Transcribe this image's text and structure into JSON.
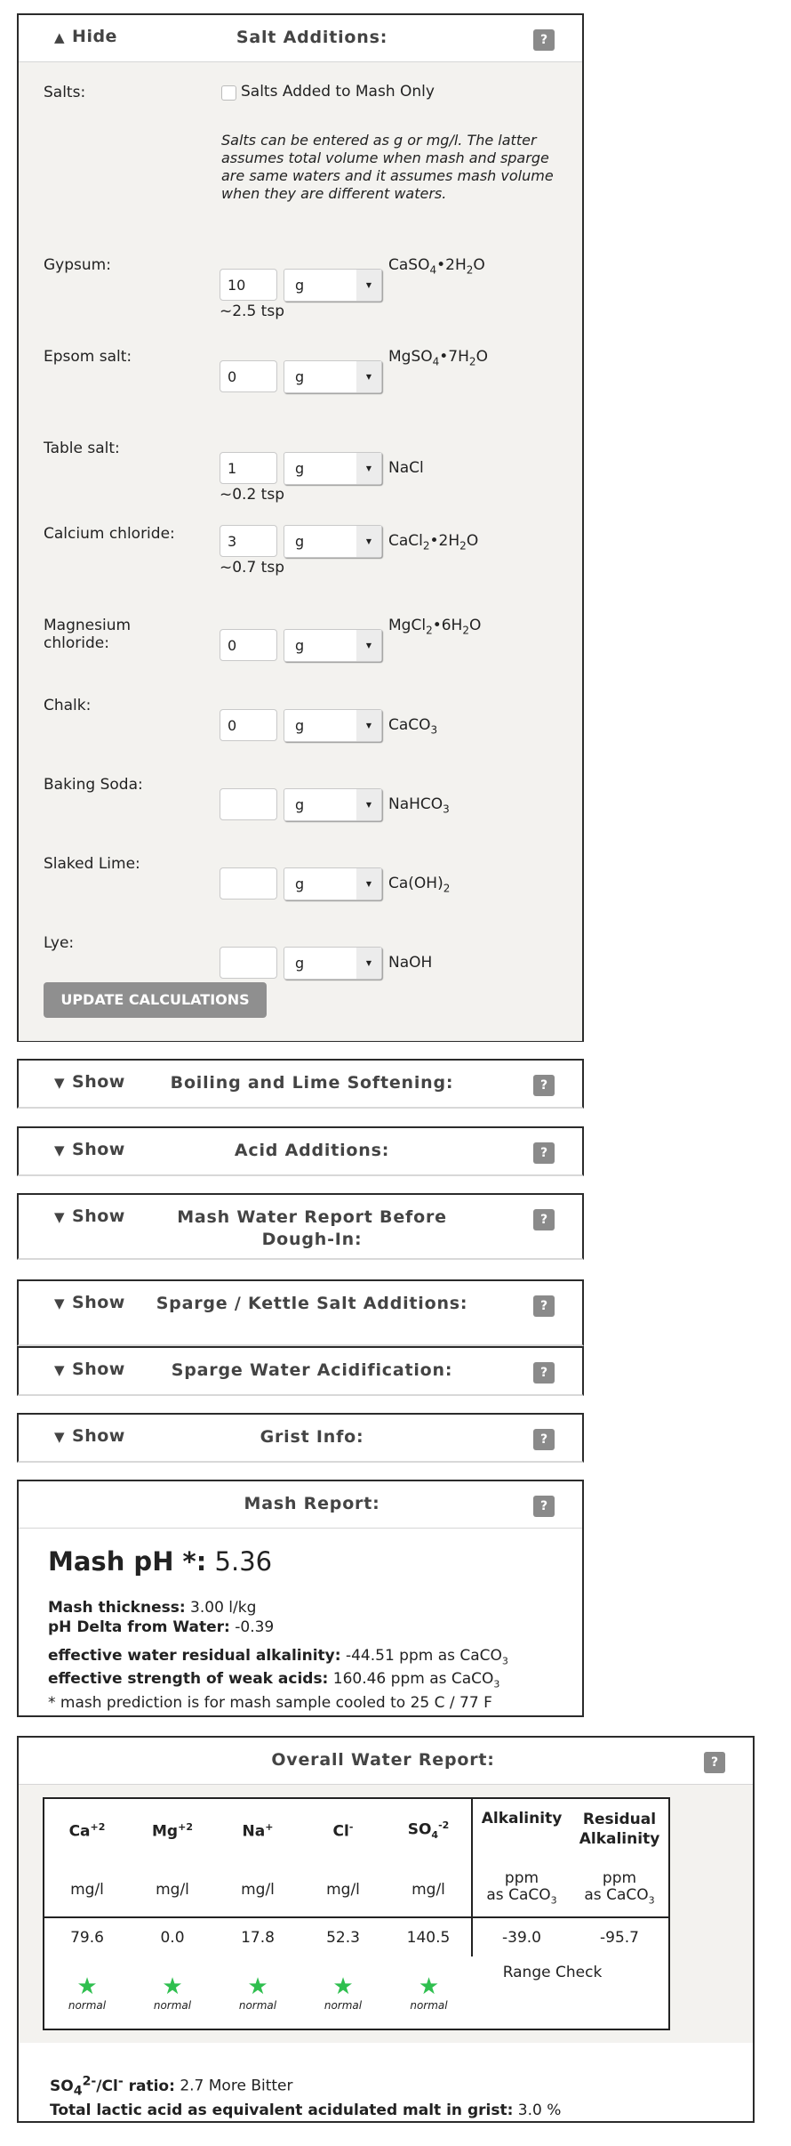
{
  "salt_additions": {
    "toggle_label": "Hide",
    "title": "Salt Additions:",
    "help_icon": "?",
    "salts_label": "Salts:",
    "mash_only_checkbox_label": "Salts Added to Mash Only",
    "mash_only_checked": false,
    "note": "Salts can be entered as g or mg/l. The latter assumes total volume when mash and sparge are same waters and it assumes mash volume when they are different waters.",
    "rows": [
      {
        "label": "Gypsum:",
        "value": "10",
        "unit": "g",
        "formula_html": "CaSO<sub>4</sub>•2H<sub>2</sub>O",
        "tsp": "~2.5 tsp"
      },
      {
        "label": "Epsom salt:",
        "value": "0",
        "unit": "g",
        "formula_html": "MgSO<sub>4</sub>•7H<sub>2</sub>O",
        "tsp": ""
      },
      {
        "label": "Table salt:",
        "value": "1",
        "unit": "g",
        "formula_html": "NaCl",
        "tsp": "~0.2 tsp"
      },
      {
        "label": "Calcium chloride:",
        "value": "3",
        "unit": "g",
        "formula_html": "CaCl<sub>2</sub>•2H<sub>2</sub>O",
        "tsp": "~0.7 tsp"
      },
      {
        "label": "Magnesium chloride:",
        "value": "0",
        "unit": "g",
        "formula_html": "MgCl<sub>2</sub>•6H<sub>2</sub>O",
        "tsp": ""
      },
      {
        "label": "Chalk:",
        "value": "0",
        "unit": "g",
        "formula_html": "CaCO<sub>3</sub>",
        "tsp": ""
      },
      {
        "label": "Baking Soda:",
        "value": "",
        "unit": "g",
        "formula_html": "NaHCO<sub>3</sub>",
        "tsp": ""
      },
      {
        "label": "Slaked Lime:",
        "value": "",
        "unit": "g",
        "formula_html": "Ca(OH)<sub>2</sub>",
        "tsp": ""
      },
      {
        "label": "Lye:",
        "value": "",
        "unit": "g",
        "formula_html": "NaOH",
        "tsp": ""
      }
    ],
    "update_button": "UPDATE CALCULATIONS"
  },
  "collapsed_sections": [
    {
      "toggle_label": "Show",
      "title": "Boiling and Lime Softening:"
    },
    {
      "toggle_label": "Show",
      "title": "Acid Additions:"
    },
    {
      "toggle_label": "Show",
      "title": "Mash Water Report Before Dough-In:"
    },
    {
      "toggle_label": "Show",
      "title": "Sparge / Kettle Salt Additions:"
    },
    {
      "toggle_label": "Show",
      "title": "Sparge Water Acidification:"
    },
    {
      "toggle_label": "Show",
      "title": "Grist Info:"
    }
  ],
  "mash_report": {
    "title": "Mash Report:",
    "ph_label": "Mash pH *:",
    "ph_value": "5.36",
    "thickness_label": "Mash thickness:",
    "thickness_value": "3.00 l/kg",
    "ph_delta_label": "pH Delta from Water:",
    "ph_delta_value": "-0.39",
    "residual_alk_label": "effective water residual alkalinity:",
    "residual_alk_value": "-44.51 ppm as CaCO",
    "weak_acids_label": "effective strength of weak acids:",
    "weak_acids_value": "160.46 ppm as CaCO",
    "footnote": "* mash prediction is for mash sample cooled to 25 C / 77 F"
  },
  "water_report": {
    "title": "Overall Water Report:",
    "columns": [
      {
        "ion_html": "Ca<sup>+2</sup>",
        "unit": "mg/l",
        "value": "79.6",
        "status": "normal"
      },
      {
        "ion_html": "Mg<sup>+2</sup>",
        "unit": "mg/l",
        "value": "0.0",
        "status": "normal"
      },
      {
        "ion_html": "Na<sup>+</sup>",
        "unit": "mg/l",
        "value": "17.8",
        "status": "normal"
      },
      {
        "ion_html": "Cl<sup>-</sup>",
        "unit": "mg/l",
        "value": "52.3",
        "status": "normal"
      },
      {
        "ion_html": "SO<sub>4</sub><sup>-2</sup>",
        "unit": "mg/l",
        "value": "140.5",
        "status": "normal"
      }
    ],
    "alkalinity": {
      "label": "Alkalinity",
      "unit_html": "ppm<br>as CaCO<sub>3</sub>",
      "value": "-39.0"
    },
    "residual_alkalinity": {
      "label_html": "Residual<br>Alkalinity",
      "unit_html": "ppm<br>as CaCO<sub>3</sub>",
      "value": "-95.7"
    },
    "range_check_label": "Range Check",
    "ratio_label_html": "SO<sub>4</sub><sup>2-</sup>/Cl<sup>-</sup> ratio:",
    "ratio_value": "2.7 More Bitter",
    "lactic_label": "Total lactic acid as equivalent acidulated malt in grist:",
    "lactic_value": "3.0 %"
  },
  "colors": {
    "star_green": "#2fbf4f",
    "button_gray": "#8f8f8f",
    "panel_bg": "#f3f2ef"
  }
}
